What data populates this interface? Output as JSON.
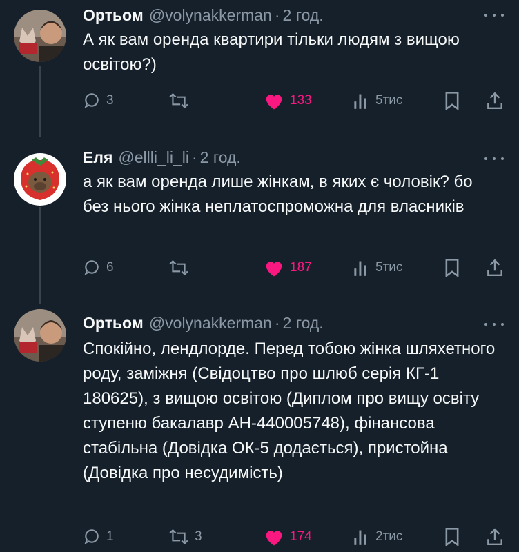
{
  "tweets": [
    {
      "author": "Ортьом",
      "handle": "@volynakkerman",
      "separator": "·",
      "time": "2 год.",
      "text": "А як вам оренда квартири тільки людям з вищою освітою?)",
      "replies": "3",
      "retweets": "",
      "likes": "133",
      "views": "5тис"
    },
    {
      "author": "Еля",
      "handle": "@ellli_li_li",
      "separator": "·",
      "time": "2 год.",
      "text": "а як вам оренда лише жінкам, в яких є чоловік? бо без нього жінка неплатоспроможна для власників",
      "replies": "6",
      "retweets": "",
      "likes": "187",
      "views": "5тис"
    },
    {
      "author": "Ортьом",
      "handle": "@volynakkerman",
      "separator": "·",
      "time": "2 год.",
      "text": "Спокійно, лендлорде. Перед тобою жінка шляхетного роду, заміжня (Свідоцтво про шлюб серія КГ-1 180625), з вищою освітою (Диплом про вищу освіту ступеню бакалавр АН-440005748), фінансова стабільна (Довідка ОК-5 додається), пристойна (Довідка про несудимість)",
      "replies": "1",
      "retweets": "3",
      "likes": "174",
      "views": "2тис"
    }
  ],
  "icons": {
    "reply": "reply-icon",
    "retweet": "retweet-icon",
    "like": "heart-icon",
    "views": "views-icon",
    "bookmark": "bookmark-icon",
    "share": "share-icon",
    "more": "more-icon"
  },
  "colors": {
    "background": "#15202b",
    "text": "#f7f9f9",
    "secondary": "#8b98a5",
    "like": "#f91880"
  }
}
